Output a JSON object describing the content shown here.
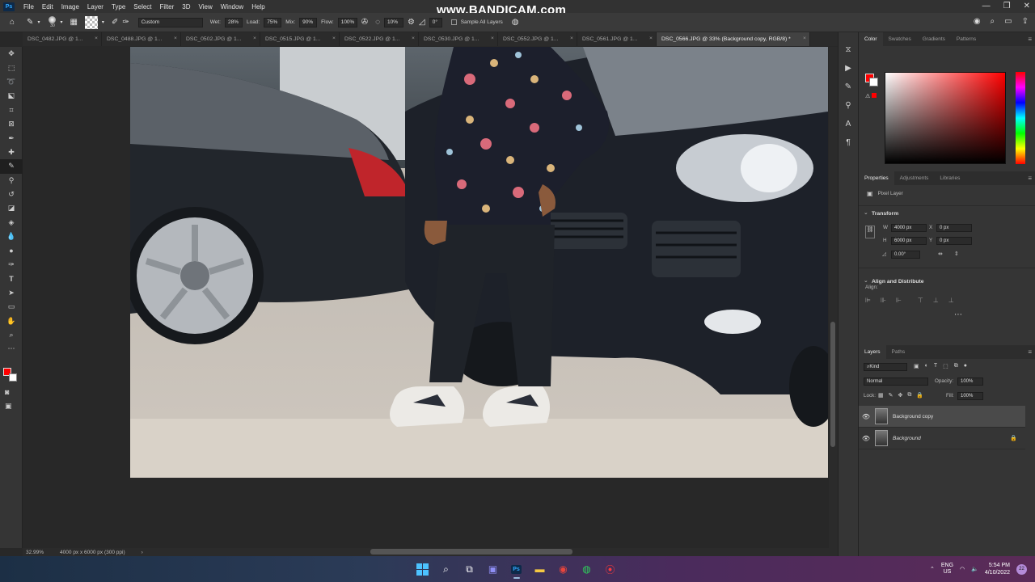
{
  "app": {
    "logo": "Ps",
    "menu": [
      "File",
      "Edit",
      "Image",
      "Layer",
      "Type",
      "Select",
      "Filter",
      "3D",
      "View",
      "Window",
      "Help"
    ],
    "watermark": "www.BANDICAM.com"
  },
  "options_bar": {
    "brush_size": "30",
    "preset": "Custom",
    "wet_label": "Wet:",
    "wet_value": "28%",
    "load_label": "Load:",
    "load_value": "75%",
    "mix_label": "Mix:",
    "mix_value": "90%",
    "flow_label": "Flow:",
    "flow_value": "100%",
    "smoothing_value": "10%",
    "angle_value": "0°",
    "sample_all_layers": "Sample All Layers"
  },
  "tabs": [
    {
      "label": "DSC_0482.JPG @ 1..."
    },
    {
      "label": "DSC_0488.JPG @ 1..."
    },
    {
      "label": "DSC_0502.JPG @ 1..."
    },
    {
      "label": "DSC_0515.JPG @ 1..."
    },
    {
      "label": "DSC_0522.JPG @ 1..."
    },
    {
      "label": "DSC_0530.JPG @ 1..."
    },
    {
      "label": "DSC_0552.JPG @ 1..."
    },
    {
      "label": "DSC_0561.JPG @ 1..."
    },
    {
      "label": "DSC_0566.JPG @ 33% (Background copy, RGB/8) *",
      "active": true
    }
  ],
  "status": {
    "zoom": "32.99%",
    "doc_info": "4000 px x 6000 px (300 ppi)"
  },
  "color_panel": {
    "tabs": [
      "Color",
      "Swatches",
      "Gradients",
      "Patterns"
    ],
    "foreground": "#ff0000",
    "background": "#ffffff"
  },
  "properties": {
    "tabs": [
      "Properties",
      "Adjustments",
      "Libraries"
    ],
    "kind": "Pixel Layer",
    "transform_title": "Transform",
    "w_label": "W",
    "w_value": "4000 px",
    "h_label": "H",
    "h_value": "6000 px",
    "x_label": "X",
    "x_value": "0 px",
    "y_label": "Y",
    "y_value": "0 px",
    "angle_value": "0.00°",
    "align_title": "Align and Distribute",
    "align_label": "Align:"
  },
  "layers_panel": {
    "tabs": [
      "Layers",
      "Paths"
    ],
    "filter": "Kind",
    "blend_mode": "Normal",
    "opacity_label": "Opacity:",
    "opacity_value": "100%",
    "lock_label": "Lock:",
    "fill_label": "Fill:",
    "fill_value": "100%",
    "layers": [
      {
        "name": "Background copy",
        "selected": true
      },
      {
        "name": "Background",
        "locked": true
      }
    ]
  },
  "taskbar": {
    "lang": "ENG",
    "region": "US",
    "time": "5:54 PM",
    "date": "4/10/2022",
    "notifications": "22"
  }
}
